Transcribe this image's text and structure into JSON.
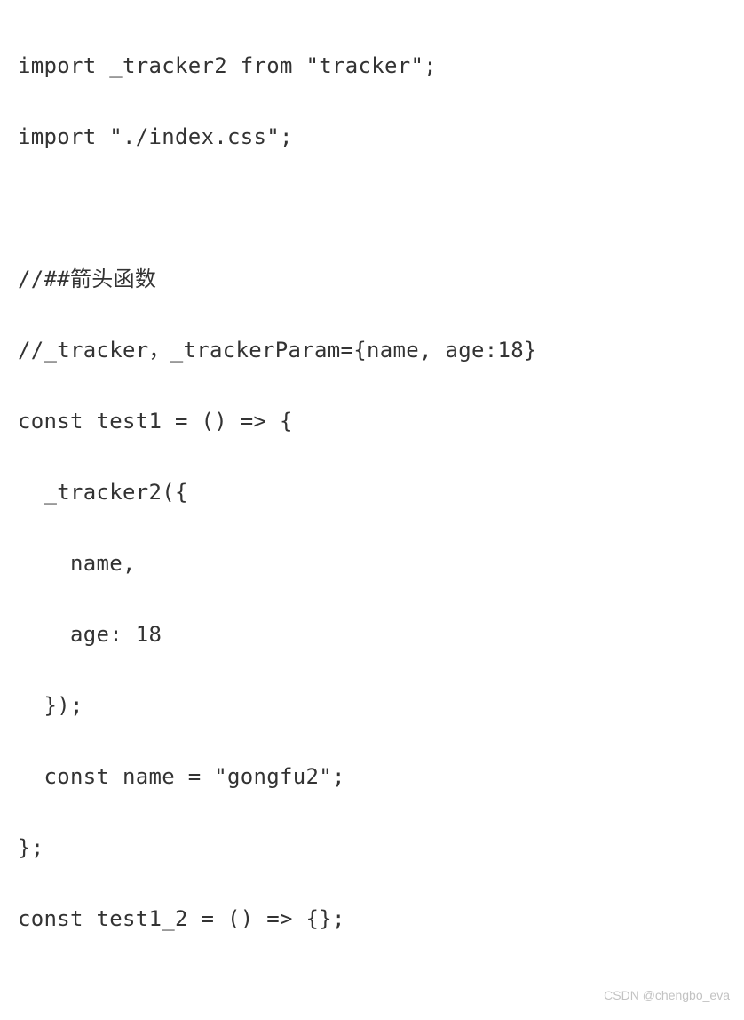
{
  "code": {
    "lines": [
      "import _tracker2 from \"tracker\";",
      "import \"./index.css\";",
      "",
      "//##箭头函数",
      "//_tracker，_trackerParam={name, age:18}",
      "const test1 = () => {",
      "  _tracker2({",
      "    name,",
      "    age: 18",
      "  });",
      "  const name = \"gongfu2\";",
      "};",
      "const test1_2 = () => {};"
    ]
  },
  "watermark": "CSDN @chengbo_eva"
}
